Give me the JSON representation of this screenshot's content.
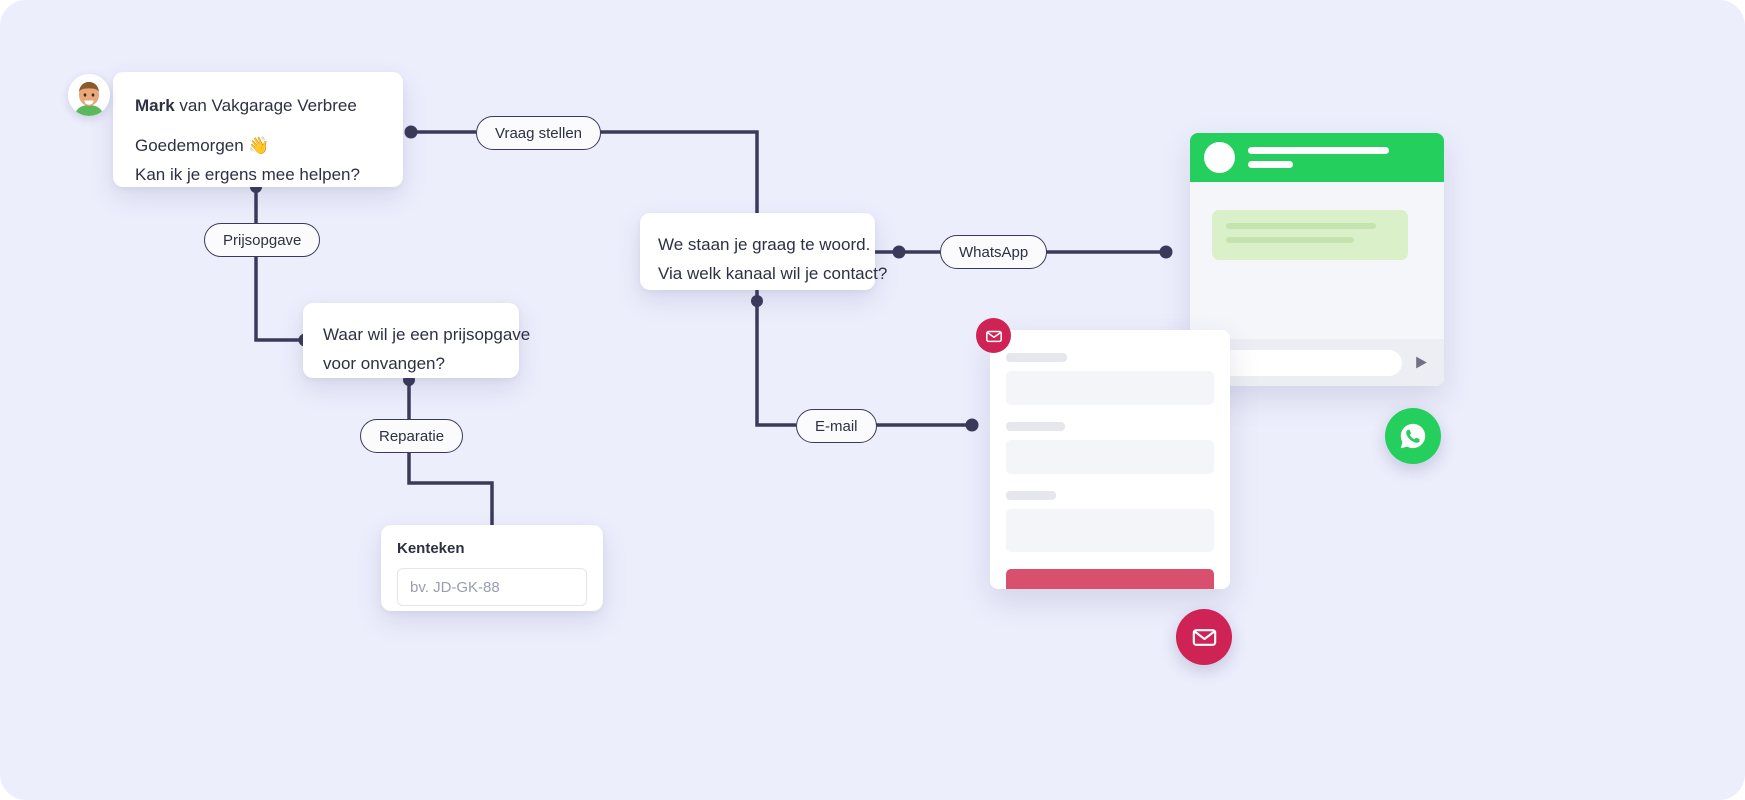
{
  "canvas": {
    "background": "#eceefc",
    "line_color": "#3b3a5a"
  },
  "intro": {
    "name": "Mark",
    "title_rest": " van Vakgarage Verbree",
    "greeting": "Goedemorgen 👋",
    "question": "Kan ik je ergens mee helpen?",
    "avatar_alt": "avatar"
  },
  "pills": {
    "vraag_stellen": "Vraag stellen",
    "prijsopgave": "Prijsopgave",
    "reparatie": "Reparatie",
    "whatsapp": "WhatsApp",
    "email": "E-mail"
  },
  "prijs_bubble": {
    "line1": "Waar wil je een prijsopgave",
    "line2": "voor onvangen?"
  },
  "kanaal_bubble": {
    "line1": "We staan je graag te woord.",
    "line2": "Via welk kanaal wil je contact?"
  },
  "kenteken_form": {
    "label": "Kenteken",
    "placeholder": "bv. JD-GK-88",
    "value": "",
    "submit_icon": "chevron-right-icon",
    "submit_color": "#22c55e"
  },
  "whatsapp_widget": {
    "header_color": "#25cf5e",
    "avatar_icon": "contact-avatar",
    "send_icon": "send-icon",
    "input_placeholder": ""
  },
  "mail_widget": {
    "badge_icon": "envelope-icon",
    "badge_color": "#cf2255",
    "submit_color": "#d9506e"
  },
  "fabs": {
    "whatsapp_icon": "whatsapp-icon",
    "whatsapp_color": "#25cf5e",
    "mail_icon": "envelope-icon",
    "mail_color": "#cf2255"
  }
}
